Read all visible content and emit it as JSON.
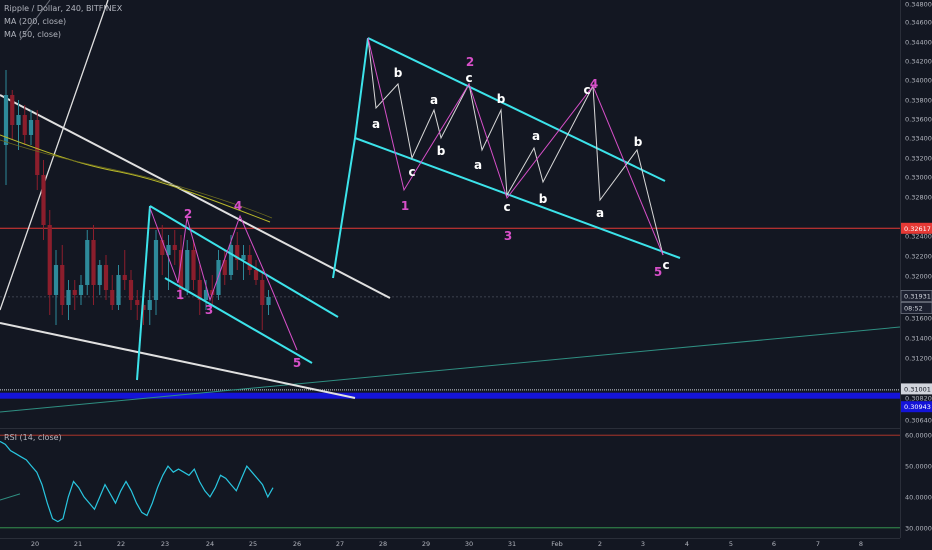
{
  "header": {
    "symbol": "Ripple / Dollar, 240, BITFINEX",
    "ma200": "MA (200, close)",
    "ma50": "MA (50, close)",
    "rsi": "RSI (14, close)"
  },
  "colors": {
    "background": "#131722",
    "bull": "#2e8a9a",
    "bear": "#8c1e2c",
    "trend_cyan": "#3ce3ea",
    "wave_magenta": "#d64fc8",
    "white_line": "#e0e0e0",
    "red_hline": "#e53935",
    "blue_band": "#1414d8",
    "ma_olive": "#b9b92a",
    "rsi_line": "#29c6e0"
  },
  "price_axis": {
    "ticks": [
      "0.34800",
      "0.34600",
      "0.34400",
      "0.34200",
      "0.34000",
      "0.33800",
      "0.33600",
      "0.33400",
      "0.33200",
      "0.33000",
      "0.32800",
      "0.32400",
      "0.32200",
      "0.32000",
      "0.31600",
      "0.31400",
      "0.31200",
      "0.30820",
      "0.30640"
    ],
    "badges": [
      {
        "id": "red-level",
        "text": "0.32617"
      },
      {
        "id": "last-price",
        "text": "0.31931"
      },
      {
        "id": "countdown",
        "text": "08:52"
      },
      {
        "id": "support",
        "text": "0.31001"
      },
      {
        "id": "blue-level",
        "text": "0.30943"
      }
    ]
  },
  "rsi_axis": {
    "ticks": [
      "60.0000",
      "50.0000",
      "40.0000",
      "30.0000"
    ]
  },
  "time_axis": {
    "labels": [
      "20",
      "21",
      "22",
      "23",
      "24",
      "25",
      "26",
      "27",
      "28",
      "29",
      "30",
      "31",
      "Feb",
      "2",
      "3",
      "4",
      "5",
      "6",
      "7",
      "8"
    ]
  },
  "chart_data": {
    "type": "candlestick",
    "title": "Ripple / Dollar, 240, BITFINEX",
    "symbol": "XRP/USD",
    "timeframe": "240",
    "exchange": "BITFINEX",
    "y_range": [
      0.3062,
      0.349
    ],
    "last_price": 0.31931,
    "levels": [
      {
        "name": "red-level",
        "value": 0.32617
      },
      {
        "name": "support",
        "value": 0.31001
      },
      {
        "name": "blue-level",
        "value": 0.30943
      }
    ],
    "candles": [
      {
        "o": 0.3345,
        "h": 0.342,
        "l": 0.3305,
        "c": 0.3395
      },
      {
        "o": 0.3395,
        "h": 0.34,
        "l": 0.335,
        "c": 0.3365
      },
      {
        "o": 0.3365,
        "h": 0.339,
        "l": 0.334,
        "c": 0.3375
      },
      {
        "o": 0.3375,
        "h": 0.3385,
        "l": 0.3345,
        "c": 0.3355
      },
      {
        "o": 0.3355,
        "h": 0.338,
        "l": 0.3345,
        "c": 0.337
      },
      {
        "o": 0.337,
        "h": 0.338,
        "l": 0.33,
        "c": 0.3315
      },
      {
        "o": 0.3315,
        "h": 0.333,
        "l": 0.325,
        "c": 0.3265
      },
      {
        "o": 0.3265,
        "h": 0.328,
        "l": 0.3175,
        "c": 0.3195
      },
      {
        "o": 0.3195,
        "h": 0.324,
        "l": 0.3165,
        "c": 0.3225
      },
      {
        "o": 0.3225,
        "h": 0.3245,
        "l": 0.3175,
        "c": 0.3185
      },
      {
        "o": 0.3185,
        "h": 0.321,
        "l": 0.317,
        "c": 0.32
      },
      {
        "o": 0.32,
        "h": 0.321,
        "l": 0.318,
        "c": 0.3195
      },
      {
        "o": 0.3195,
        "h": 0.3215,
        "l": 0.3185,
        "c": 0.3205
      },
      {
        "o": 0.3205,
        "h": 0.326,
        "l": 0.3195,
        "c": 0.325
      },
      {
        "o": 0.325,
        "h": 0.3265,
        "l": 0.3185,
        "c": 0.3205
      },
      {
        "o": 0.3205,
        "h": 0.323,
        "l": 0.3195,
        "c": 0.3225
      },
      {
        "o": 0.3225,
        "h": 0.3235,
        "l": 0.319,
        "c": 0.32
      },
      {
        "o": 0.32,
        "h": 0.3215,
        "l": 0.318,
        "c": 0.3185
      },
      {
        "o": 0.3185,
        "h": 0.3225,
        "l": 0.318,
        "c": 0.3215
      },
      {
        "o": 0.3215,
        "h": 0.324,
        "l": 0.32,
        "c": 0.321
      },
      {
        "o": 0.321,
        "h": 0.322,
        "l": 0.318,
        "c": 0.319
      },
      {
        "o": 0.319,
        "h": 0.32,
        "l": 0.317,
        "c": 0.3185
      },
      {
        "o": 0.3185,
        "h": 0.3195,
        "l": 0.3165,
        "c": 0.318
      },
      {
        "o": 0.318,
        "h": 0.32,
        "l": 0.3165,
        "c": 0.319
      },
      {
        "o": 0.319,
        "h": 0.326,
        "l": 0.3175,
        "c": 0.325
      },
      {
        "o": 0.325,
        "h": 0.3265,
        "l": 0.3215,
        "c": 0.3235
      },
      {
        "o": 0.3235,
        "h": 0.3255,
        "l": 0.32,
        "c": 0.3245
      },
      {
        "o": 0.3245,
        "h": 0.326,
        "l": 0.3225,
        "c": 0.324
      },
      {
        "o": 0.324,
        "h": 0.3255,
        "l": 0.319,
        "c": 0.32
      },
      {
        "o": 0.32,
        "h": 0.325,
        "l": 0.3195,
        "c": 0.324
      },
      {
        "o": 0.324,
        "h": 0.325,
        "l": 0.32,
        "c": 0.321
      },
      {
        "o": 0.321,
        "h": 0.3225,
        "l": 0.3175,
        "c": 0.319
      },
      {
        "o": 0.319,
        "h": 0.321,
        "l": 0.318,
        "c": 0.32
      },
      {
        "o": 0.32,
        "h": 0.3215,
        "l": 0.3185,
        "c": 0.3195
      },
      {
        "o": 0.3195,
        "h": 0.324,
        "l": 0.319,
        "c": 0.323
      },
      {
        "o": 0.323,
        "h": 0.324,
        "l": 0.3205,
        "c": 0.3215
      },
      {
        "o": 0.3215,
        "h": 0.3255,
        "l": 0.321,
        "c": 0.3245
      },
      {
        "o": 0.3245,
        "h": 0.3258,
        "l": 0.322,
        "c": 0.323
      },
      {
        "o": 0.323,
        "h": 0.3245,
        "l": 0.321,
        "c": 0.3235
      },
      {
        "o": 0.3235,
        "h": 0.3245,
        "l": 0.3215,
        "c": 0.322
      },
      {
        "o": 0.322,
        "h": 0.323,
        "l": 0.3205,
        "c": 0.321
      },
      {
        "o": 0.321,
        "h": 0.322,
        "l": 0.316,
        "c": 0.3185
      },
      {
        "o": 0.3185,
        "h": 0.32,
        "l": 0.3175,
        "c": 0.3193
      }
    ],
    "rsi": {
      "y_range": [
        28,
        62
      ],
      "values": [
        58,
        57,
        55,
        54,
        53,
        52,
        50,
        48,
        44,
        38,
        33,
        32,
        33,
        40,
        45,
        43,
        40,
        38,
        36,
        40,
        44,
        41,
        38,
        42,
        45,
        42,
        38,
        35,
        34,
        38,
        43,
        47,
        50,
        48,
        49,
        48,
        47,
        49,
        45,
        42,
        40,
        43,
        47,
        46,
        44,
        42,
        46,
        50,
        48,
        46,
        44,
        40,
        43
      ]
    },
    "annotations": {
      "wave_labels": [
        "2",
        "4",
        "1",
        "3",
        "5",
        "1",
        "2",
        "3",
        "4",
        "5"
      ],
      "abc_labels": [
        "a",
        "b",
        "c",
        "a",
        "b",
        "c",
        "a",
        "b",
        "c",
        "a",
        "b",
        "c",
        "a",
        "b",
        "c"
      ]
    }
  }
}
